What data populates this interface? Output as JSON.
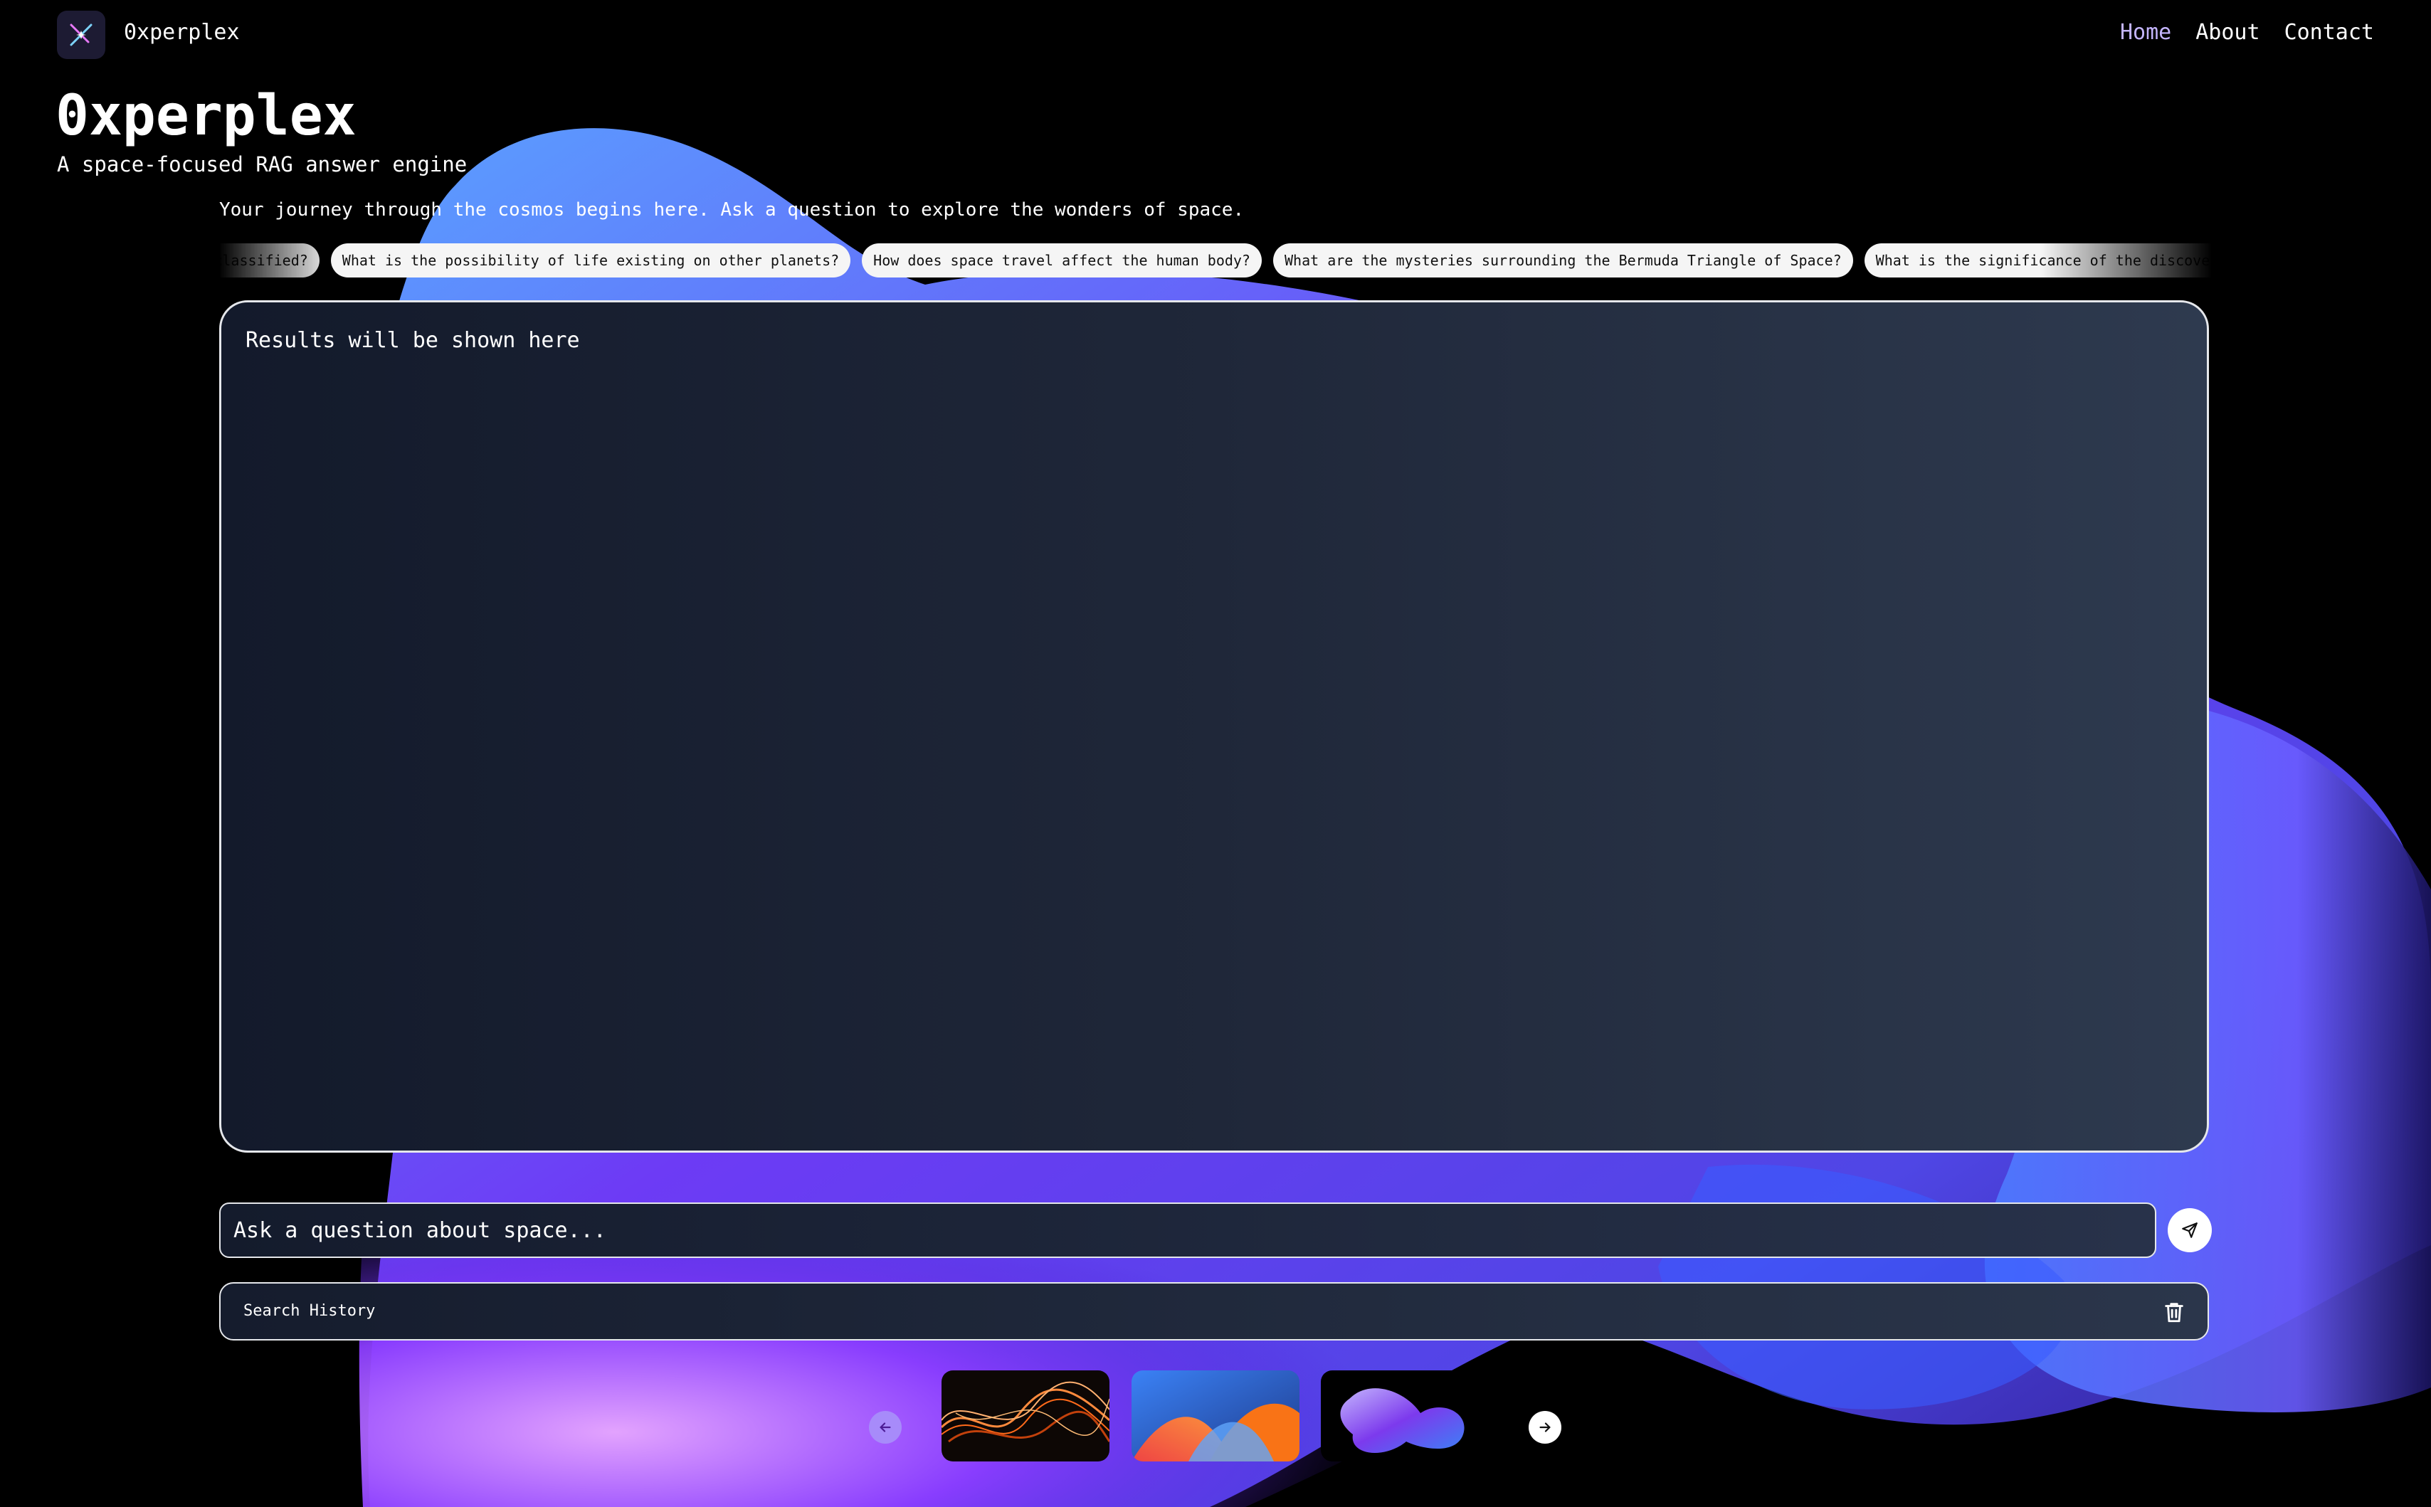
{
  "header": {
    "brand": "0xperplex",
    "logo_icon": "sparkle-x-logo-icon",
    "nav": [
      {
        "label": "Home",
        "active": true
      },
      {
        "label": "About",
        "active": false
      },
      {
        "label": "Contact",
        "active": false
      }
    ]
  },
  "hero": {
    "title": "0xperplex",
    "subtitle": "A space-focused RAG answer engine"
  },
  "intro": "Your journey through the cosmos begins here. Ask a question to explore the wonders of space.",
  "suggestions": [
    "What is classified?",
    "What is the possibility of life existing on other planets?",
    "How does space travel affect the human body?",
    "What are the mysteries surrounding the Bermuda Triangle of Space?",
    "What is the significance of the discovery of gravitational waves?"
  ],
  "results": {
    "placeholder": "Results will be shown here"
  },
  "ask": {
    "placeholder": "Ask a question about space...",
    "send_icon": "send-icon"
  },
  "history": {
    "label": "Search History",
    "clear_icon": "trash-icon"
  },
  "carousel": {
    "prev_icon": "arrow-left-icon",
    "next_icon": "arrow-right-icon",
    "thumbnails": [
      "orange-wave-abstract",
      "red-blue-folds-abstract",
      "purple-blob-abstract"
    ]
  },
  "colors": {
    "background": "#000000",
    "accent": "#c4b5fd",
    "blob_blue": "#4f8cff",
    "blob_purple": "#7c3aed",
    "panel": "#1f2739"
  }
}
